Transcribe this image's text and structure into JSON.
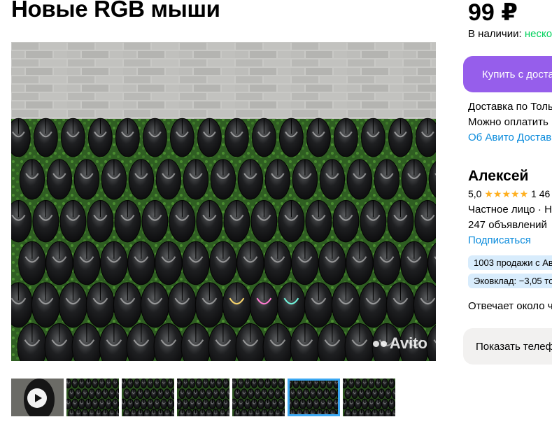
{
  "listing": {
    "title": "Новые RGB мыши"
  },
  "gallery": {
    "watermark": "Avito",
    "thumbnails": [
      {
        "kind": "video"
      },
      {
        "kind": "photo"
      },
      {
        "kind": "photo"
      },
      {
        "kind": "photo"
      },
      {
        "kind": "photo"
      },
      {
        "kind": "photo",
        "active": true
      },
      {
        "kind": "photo"
      }
    ]
  },
  "sidebar": {
    "price": "99 ₽",
    "stock_label": "В наличии:",
    "stock_value": "неско",
    "buy_button": "Купить с доста",
    "delivery_line": "Доставка по Толь",
    "payment_line": "Можно оплатить",
    "delivery_link": "Об Авито Достав",
    "seller": {
      "name": "Алексей",
      "rating": "5,0",
      "stars": "★★★★★",
      "reviews": "1 46",
      "type": "Частное лицо · Н",
      "ads_count": "247 объявлений",
      "subscribe": "Подписаться",
      "sales_badge": "1003 продажи с Ав",
      "eco_badge": "Эковклад: −3,05 то",
      "response": "Отвечает около ч"
    },
    "phone_button": "Показать телеф"
  },
  "colors": {
    "accent_purple": "#965eeb",
    "link_blue": "#0a8bdc",
    "in_stock_green": "#02d15c",
    "star_gold": "#ffb021",
    "badge_blue": "#d8ecfc",
    "active_thumb": "#3aa7f2"
  }
}
